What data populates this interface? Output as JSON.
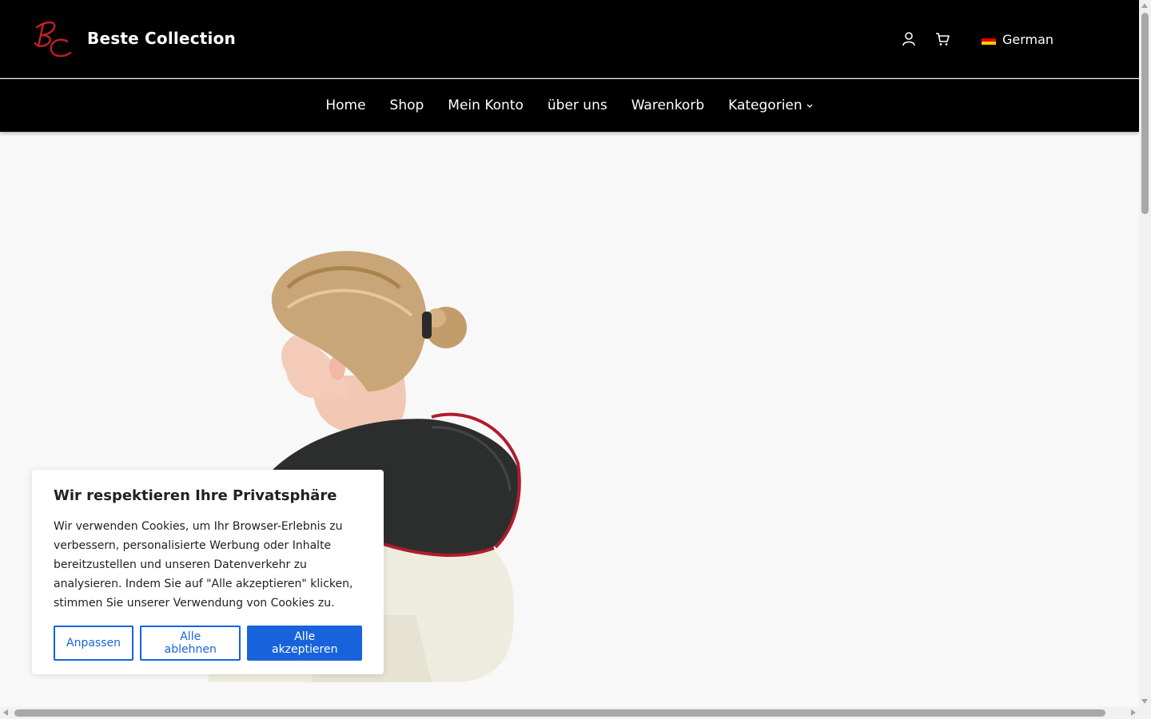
{
  "header": {
    "site_title": "Beste Collection",
    "logo_icon": "bc-logo-icon",
    "account_icon": "user-icon",
    "cart_icon": "shopping-cart-icon",
    "language_label": "German",
    "language_flag": "germany-flag-icon"
  },
  "nav": {
    "items": [
      {
        "label": "Home"
      },
      {
        "label": "Shop"
      },
      {
        "label": "Mein Konto"
      },
      {
        "label": "über uns"
      },
      {
        "label": "Warenkorb"
      },
      {
        "label": "Kategorien",
        "icon": "chevron-down-icon"
      }
    ]
  },
  "cookie_banner": {
    "title": "Wir respektieren Ihre Privatsphäre",
    "text": "Wir verwenden Cookies, um Ihr Browser-Erlebnis zu verbessern, personalisierte Werbung oder Inhalte bereitzustellen und unseren Datenverkehr zu analysieren. Indem Sie auf \"Alle akzeptieren\" klicken, stimmen Sie unserer Verwendung von Cookies zu.",
    "buttons": {
      "customize": "Anpassen",
      "reject": "Alle ablehnen",
      "accept": "Alle akzeptieren"
    }
  },
  "colors": {
    "header_bg": "#000000",
    "page_bg": "#f8f8f8",
    "accent_blue": "#1863dc",
    "logo_red": "#c0202a"
  }
}
